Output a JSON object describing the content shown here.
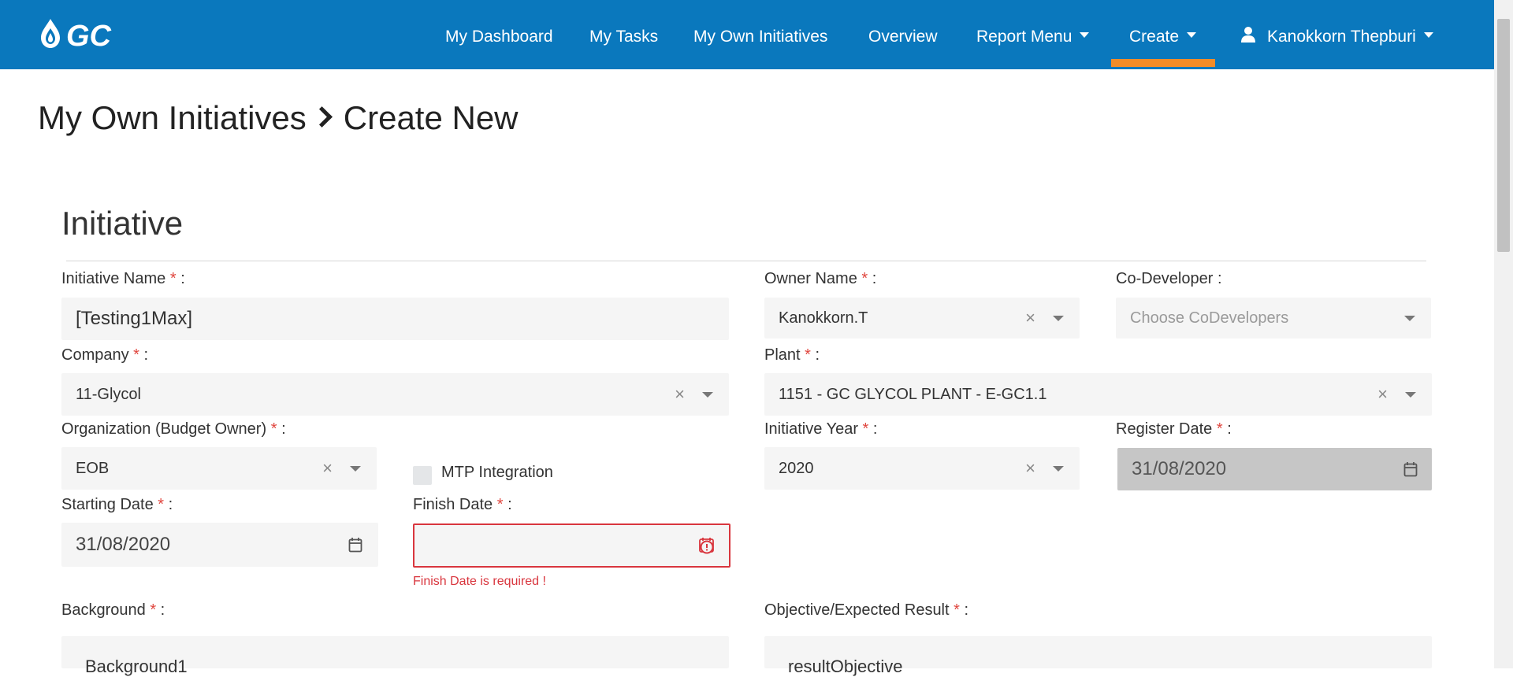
{
  "app": {
    "brand": "GC"
  },
  "nav": {
    "items": [
      {
        "label": "My Dashboard"
      },
      {
        "label": "My Tasks"
      },
      {
        "label": "My Own Initiatives"
      },
      {
        "label": "Overview"
      },
      {
        "label": "Report Menu"
      },
      {
        "label": "Create"
      }
    ],
    "active": "Create",
    "user": "Kanokkorn Thepburi",
    "colors": {
      "bar": "#0a78bd",
      "active_indicator": "#f28c28"
    }
  },
  "breadcrumb": {
    "parent": "My Own Initiatives",
    "current": "Create New"
  },
  "section": {
    "title": "Initiative"
  },
  "form": {
    "initiative_name": {
      "label": "Initiative Name",
      "suffix": ":",
      "required": "*",
      "value": "[Testing1Max]"
    },
    "owner_name": {
      "label": "Owner Name",
      "suffix": ":",
      "required": "*",
      "value": "Kanokkorn.T"
    },
    "co_developer": {
      "label": "Co-Developer :",
      "placeholder": "Choose CoDevelopers"
    },
    "company": {
      "label": "Company",
      "suffix": ":",
      "required": "*",
      "value": "11-Glycol"
    },
    "plant": {
      "label": "Plant",
      "suffix": ":",
      "required": "*",
      "value": "1151 - GC GLYCOL PLANT - E-GC1.1"
    },
    "organization": {
      "label": "Organization (Budget Owner)",
      "suffix": ":",
      "required": "*",
      "value": "EOB"
    },
    "mtp_integration": {
      "label": "MTP Integration",
      "checked": false
    },
    "initiative_year": {
      "label": "Initiative Year",
      "suffix": ":",
      "required": "*",
      "value": "2020"
    },
    "register_date": {
      "label": "Register Date",
      "suffix": ":",
      "required": "*",
      "value": "31/08/2020"
    },
    "starting_date": {
      "label": "Starting Date",
      "suffix": ":",
      "required": "*",
      "value": "31/08/2020"
    },
    "finish_date": {
      "label": "Finish Date",
      "suffix": ":",
      "required": "*",
      "value": "",
      "error": "Finish Date is required !"
    },
    "background": {
      "label": "Background",
      "suffix": ":",
      "required": "*",
      "value": "Background1"
    },
    "objective": {
      "label": "Objective/Expected Result",
      "suffix": ":",
      "required": "*",
      "value": "resultObjective"
    }
  },
  "icons": [
    "gc-logo",
    "caret-down-icon",
    "user-icon",
    "clear-icon",
    "calendar-icon",
    "error-icon"
  ]
}
